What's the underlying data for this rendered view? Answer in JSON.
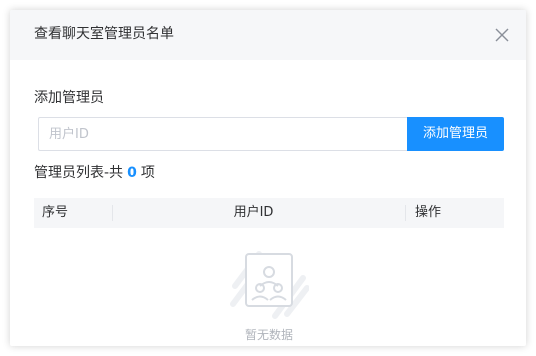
{
  "dialog": {
    "title": "查看聊天室管理员名单",
    "close_icon": "close-icon"
  },
  "add_section": {
    "label": "添加管理员",
    "input_placeholder": "用户ID",
    "input_value": "",
    "add_button_label": "添加管理员",
    "accent_color": "#1890ff"
  },
  "list": {
    "title_prefix": "管理员列表-共",
    "count": "0",
    "title_suffix": "项",
    "columns": [
      "序号",
      "用户ID",
      "操作"
    ],
    "rows": [],
    "empty_text": "暂无数据",
    "empty_icon": "no-users-icon"
  }
}
